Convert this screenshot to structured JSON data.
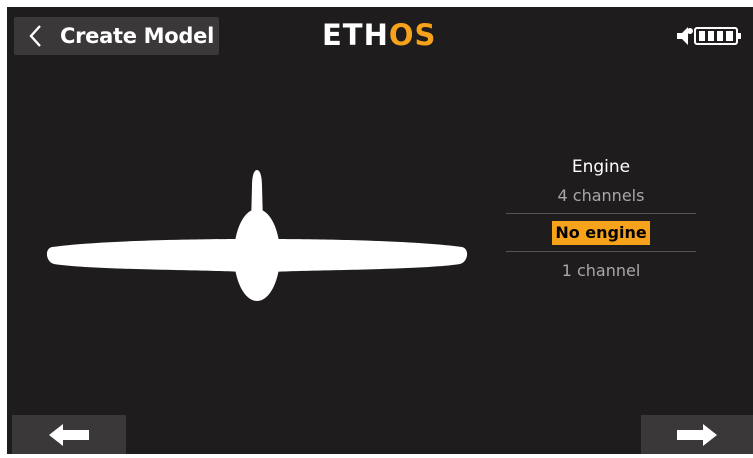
{
  "header": {
    "back_icon": "chevron-left-icon",
    "title": "Create Model",
    "logo_primary": "ETH",
    "logo_accent": "OS",
    "status_icons": [
      "speaker-icon",
      "battery-icon"
    ]
  },
  "illustration": {
    "icon": "airplane-front-view-icon"
  },
  "engine_selector": {
    "heading": "Engine",
    "options": [
      {
        "label": "4 channels",
        "selected": false
      },
      {
        "label": "No engine",
        "selected": true
      },
      {
        "label": "1 channel",
        "selected": false
      }
    ]
  },
  "footer": {
    "prev_icon": "arrow-left-icon",
    "next_icon": "arrow-right-icon"
  },
  "colors": {
    "background": "#1e1c1d",
    "button": "#3a3839",
    "accent": "#f7a21b",
    "text": "#ffffff",
    "muted_text": "#a9a7a8"
  }
}
